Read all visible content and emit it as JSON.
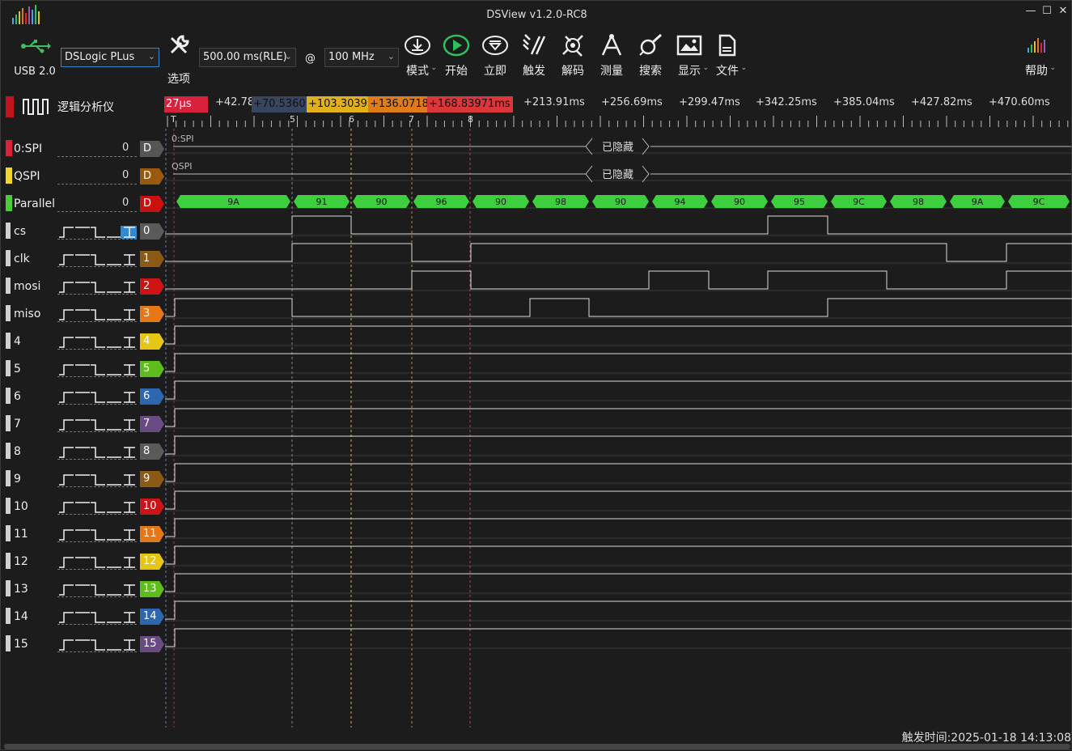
{
  "window": {
    "title": "DSView v1.2.0-RC8",
    "min": "—",
    "max": "☐",
    "close": "✕"
  },
  "toolbar": {
    "usb_label": "USB 2.0",
    "device": "DSLogic PLus",
    "duration": "500.00 ms(RLE)",
    "at": "@",
    "rate": "100 MHz",
    "options_label": "选项",
    "mode_label": "模式",
    "start_label": "开始",
    "instant_label": "立即",
    "trigger_label": "触发",
    "decode_label": "解码",
    "measure_label": "测量",
    "search_label": "搜索",
    "display_label": "显示",
    "file_label": "文件",
    "help_label": "帮助"
  },
  "group": {
    "label": "逻辑分析仪"
  },
  "ruler": {
    "labels": [
      "+42.78ms",
      "+213.91ms",
      "+256.69ms",
      "+299.47ms",
      "+342.25ms",
      "+385.04ms",
      "+427.82ms",
      "+470.60ms"
    ],
    "cursors": [
      {
        "text": "27μs",
        "color": "#d8213c",
        "marker": "T"
      },
      {
        "text": "+70.5360",
        "color": "#37455f",
        "marker": "5"
      },
      {
        "text": "+103.3039",
        "color": "#e2b11a",
        "marker": "6"
      },
      {
        "text": "+136.0718",
        "color": "#e07b1a",
        "marker": "7"
      },
      {
        "text": "+168.83971ms",
        "color": "#d9373a",
        "marker": "8"
      }
    ]
  },
  "decoders": [
    {
      "name": "0:SPI",
      "color": "#d8213c",
      "num": "0",
      "badge": "D",
      "badge_color": "#555555",
      "label": "0:SPI",
      "hidden": "已隐藏"
    },
    {
      "name": "QSPI",
      "color": "#f2d62a",
      "num": "0",
      "badge": "D",
      "badge_color": "#9a5a0e",
      "label": "QSPI",
      "hidden": "已隐藏"
    },
    {
      "name": "Parallel",
      "color": "#4ccc3a",
      "num": "0",
      "badge": "D",
      "badge_color": "#cc1010",
      "values": [
        "9A",
        "91",
        "90",
        "96",
        "90",
        "98",
        "90",
        "94",
        "90",
        "95",
        "9C",
        "98",
        "9A",
        "9C"
      ]
    }
  ],
  "channels": [
    {
      "name": "cs",
      "badge": "0",
      "color": "#5a5a5a"
    },
    {
      "name": "clk",
      "badge": "1",
      "color": "#8a5a16"
    },
    {
      "name": "mosi",
      "badge": "2",
      "color": "#cc1414"
    },
    {
      "name": "miso",
      "badge": "3",
      "color": "#e67716"
    },
    {
      "name": "4",
      "badge": "4",
      "color": "#e6c514"
    },
    {
      "name": "5",
      "badge": "5",
      "color": "#5cbd1c"
    },
    {
      "name": "6",
      "badge": "6",
      "color": "#2f66b0"
    },
    {
      "name": "7",
      "badge": "7",
      "color": "#6a4a82"
    },
    {
      "name": "8",
      "badge": "8",
      "color": "#5a5a5a"
    },
    {
      "name": "9",
      "badge": "9",
      "color": "#8a5a16"
    },
    {
      "name": "10",
      "badge": "10",
      "color": "#cc1414"
    },
    {
      "name": "11",
      "badge": "11",
      "color": "#e67716"
    },
    {
      "name": "12",
      "badge": "12",
      "color": "#e6c514"
    },
    {
      "name": "13",
      "badge": "13",
      "color": "#5cbd1c"
    },
    {
      "name": "14",
      "badge": "14",
      "color": "#2f66b0"
    },
    {
      "name": "15",
      "badge": "15",
      "color": "#6a4a82"
    }
  ],
  "status": {
    "trigger_time": "触发时间:2025-01-18 14:13:08"
  }
}
